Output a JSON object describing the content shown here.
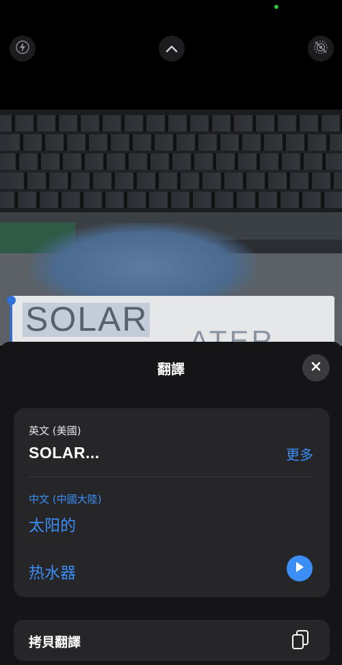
{
  "camera": {
    "icons": [
      "flash-off-icon",
      "chevron-up-icon",
      "live-photo-off-icon"
    ],
    "scanned_text_line1": "SOLAR",
    "scanned_text_line2": "ATER"
  },
  "sheet": {
    "title": "翻譯",
    "close_icon": "close-icon",
    "source": {
      "language": "英文 (美國)",
      "text": "SOLAR...",
      "more_label": "更多"
    },
    "target": {
      "language": "中文 (中國大陸)",
      "line1": "太阳的",
      "line2": "热水器",
      "play_icon": "play-icon"
    },
    "copy": {
      "label": "拷貝翻譯",
      "icon": "copy-icon"
    }
  },
  "colors": {
    "accent": "#3a8ef6",
    "sheet_bg": "#151517",
    "card_bg": "#262628",
    "selection": "#2f6fd8"
  }
}
